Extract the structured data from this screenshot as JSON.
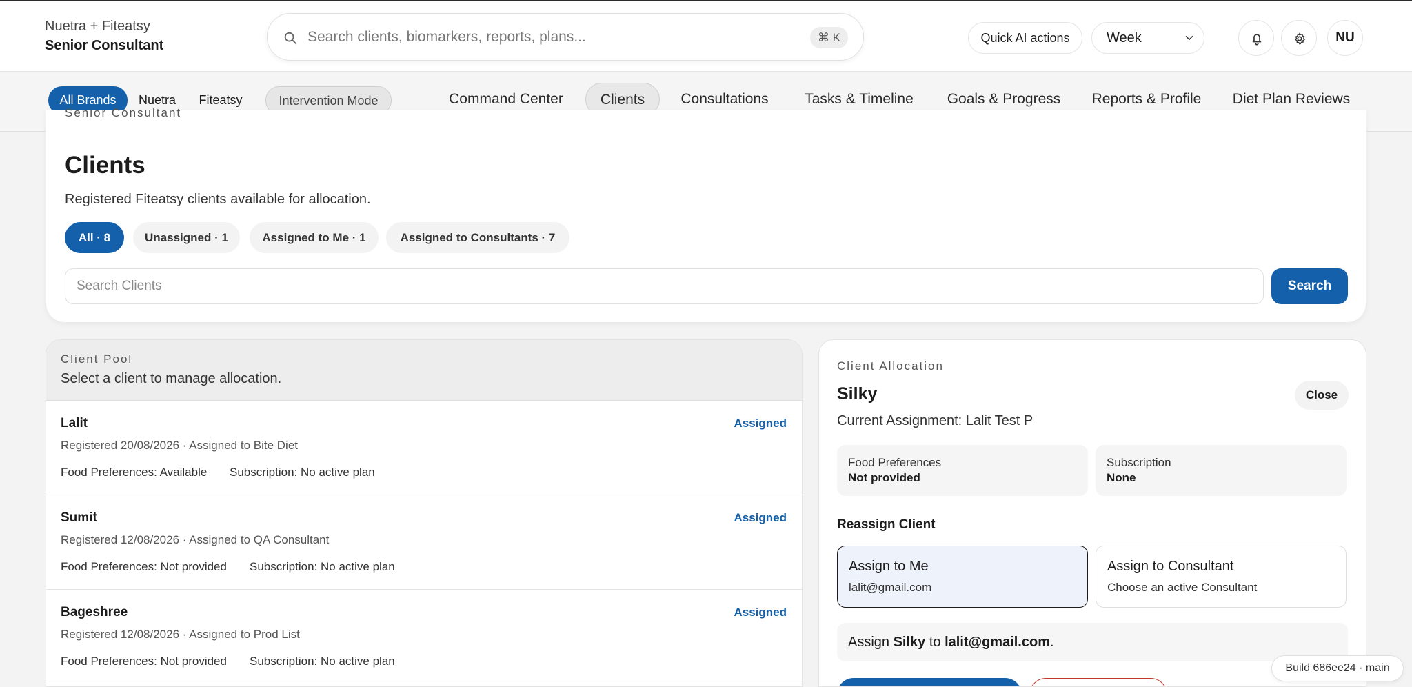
{
  "header": {
    "brand_line1": "Nuetra + Fiteatsy",
    "brand_line2": "Senior Consultant",
    "search_placeholder": "Search clients, biomarkers, reports, plans...",
    "shortcut": "⌘ K",
    "quick_ai_label": "Quick AI actions",
    "period_selected": "Week",
    "avatar_initials": "NU",
    "icons": [
      "search-icon",
      "chevron-down-icon",
      "bell-icon",
      "gear-icon"
    ]
  },
  "subnav": {
    "brands": [
      "All Brands",
      "Nuetra",
      "Fiteatsy"
    ],
    "mode_label": "Intervention Mode",
    "tabs": [
      "Command Center",
      "Clients",
      "Consultations",
      "Tasks & Timeline",
      "Goals & Progress",
      "Reports & Profile",
      "Diet Plan Reviews"
    ],
    "active_tab": "Clients"
  },
  "clients_card": {
    "eyebrow": "Senior Consultant",
    "title": "Clients",
    "subtitle": "Registered Fiteatsy clients available for allocation.",
    "filters": [
      "All · 8",
      "Unassigned · 1",
      "Assigned to Me · 1",
      "Assigned to Consultants · 7"
    ],
    "search_placeholder": "Search Clients",
    "search_button": "Search"
  },
  "pool": {
    "eyebrow": "Client Pool",
    "subtitle": "Select a client to manage allocation.",
    "rows": [
      {
        "name": "Lalit",
        "status": "Assigned",
        "meta": "Registered 20/08/2026 · Assigned to Bite Diet",
        "food": "Food Preferences: Available",
        "subscription": "Subscription: No active plan"
      },
      {
        "name": "Sumit",
        "status": "Assigned",
        "meta": "Registered 12/08/2026 · Assigned to QA Consultant",
        "food": "Food Preferences: Not provided",
        "subscription": "Subscription: No active plan"
      },
      {
        "name": "Bageshree",
        "status": "Assigned",
        "meta": "Registered 12/08/2026 · Assigned to Prod List",
        "food": "Food Preferences: Not provided",
        "subscription": "Subscription: No active plan"
      }
    ]
  },
  "allocation": {
    "eyebrow": "Client Allocation",
    "client_name": "Silky",
    "close_label": "Close",
    "current_assignment": "Current Assignment: Lalit Test P",
    "food_label": "Food Preferences",
    "food_value": "Not provided",
    "subscription_label": "Subscription",
    "subscription_value": "None",
    "reassign_title": "Reassign Client",
    "option_me_title": "Assign to Me",
    "option_me_desc": "lalit@gmail.com",
    "option_consultant_title": "Assign to Consultant",
    "option_consultant_desc": "Choose an active Consultant",
    "summary_prefix": "Assign",
    "summary_client": "Silky",
    "summary_mid": "to",
    "summary_target": "lalit@gmail.com",
    "summary_end": "."
  },
  "build": "Build 686ee24 · main",
  "colors": {
    "accent": "#1460aa",
    "danger": "#c0392b"
  }
}
